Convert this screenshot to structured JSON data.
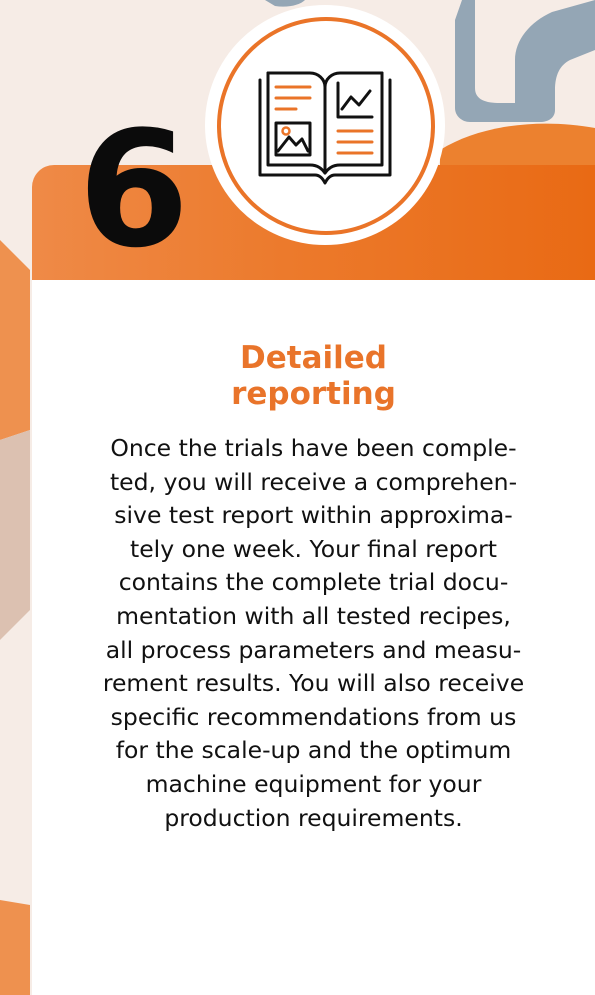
{
  "step": {
    "number": "6",
    "icon": "open-report-book-icon"
  },
  "title": {
    "lines": [
      "Detailed",
      "reporting"
    ]
  },
  "body": {
    "lines": [
      "Once the trials have been comple-",
      "ted, you will receive a comprehen-",
      "sive test report within approxima-",
      "tely one week. Your final report",
      "contains the complete trial docu-",
      "mentation with all tested recipes,",
      "all process parameters and measu-",
      "rement results. You will also receive",
      "specific recommendations from us",
      "for the scale-up and the optimum",
      "machine equipment for your",
      "production requirements."
    ]
  },
  "colors": {
    "accent": "#e9742a",
    "header_gradient_start": "#ef8a47",
    "header_gradient_end": "#e96a14",
    "background": "#f6ece6",
    "card": "#ffffff",
    "number": "#0b0b0b",
    "text": "#111111",
    "decor_blue": "#94a6b5"
  }
}
